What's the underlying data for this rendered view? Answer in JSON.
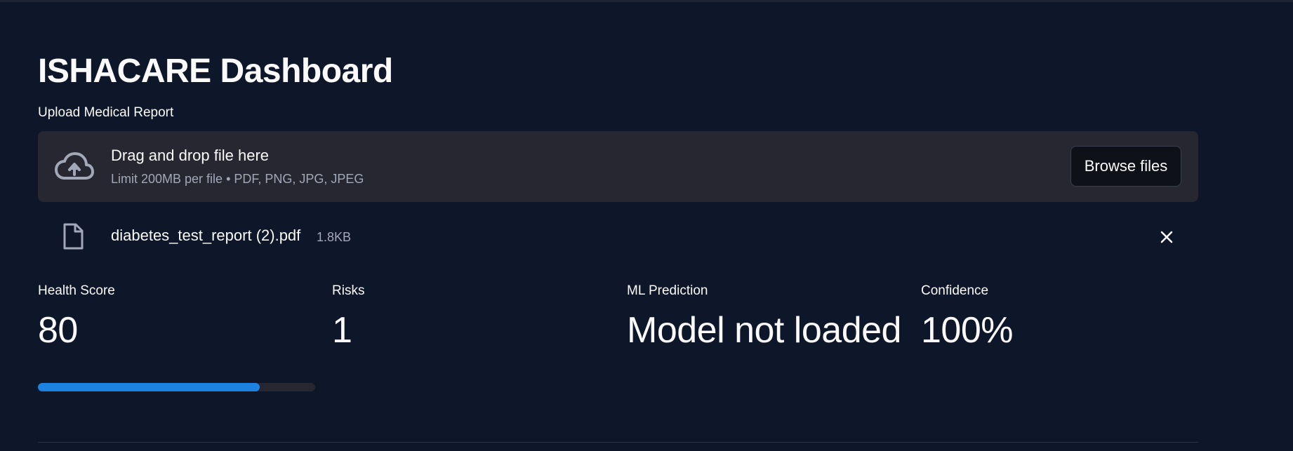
{
  "page": {
    "title": "ISHACARE Dashboard"
  },
  "uploader": {
    "label": "Upload Medical Report",
    "drop_text": "Drag and drop file here",
    "limit_text": "Limit 200MB per file • PDF, PNG, JPG, JPEG",
    "browse_label": "Browse files",
    "icon": "cloud-upload-icon"
  },
  "uploaded_file": {
    "name": "diabetes_test_report (2).pdf",
    "size": "1.8KB",
    "icon": "file-icon",
    "remove_icon": "close-icon"
  },
  "metrics": [
    {
      "label": "Health Score",
      "value": "80"
    },
    {
      "label": "Risks",
      "value": "1"
    },
    {
      "label": "ML Prediction",
      "value": "Model not loaded"
    },
    {
      "label": "Confidence",
      "value": "100%"
    }
  ],
  "health_progress": {
    "value": 0.8
  },
  "colors": {
    "background": "#0e1629",
    "surface": "#262730",
    "accent": "#1c83e1",
    "muted_text": "#a3a8b8"
  }
}
